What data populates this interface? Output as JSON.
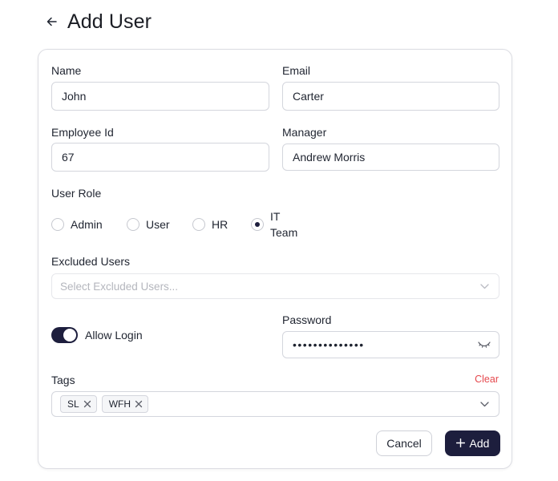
{
  "header": {
    "title": "Add User"
  },
  "form": {
    "name": {
      "label": "Name",
      "value": "John"
    },
    "email": {
      "label": "Email",
      "value": "Carter"
    },
    "employee_id": {
      "label": "Employee Id",
      "value": "67"
    },
    "manager": {
      "label": "Manager",
      "value": "Andrew Morris"
    },
    "user_role": {
      "label": "User Role",
      "options": [
        {
          "label": "Admin",
          "selected": false
        },
        {
          "label": "User",
          "selected": false
        },
        {
          "label": "HR",
          "selected": false
        },
        {
          "label": "IT Team",
          "selected": true
        }
      ]
    },
    "excluded_users": {
      "label": "Excluded Users",
      "placeholder": "Select Excluded Users..."
    },
    "allow_login": {
      "label": "Allow Login",
      "enabled": true
    },
    "password": {
      "label": "Password",
      "masked_value": "••••••••••••••"
    },
    "tags": {
      "label": "Tags",
      "clear_label": "Clear",
      "items": [
        "SL",
        "WFH"
      ]
    }
  },
  "actions": {
    "cancel_label": "Cancel",
    "add_label": "Add"
  },
  "colors": {
    "primary": "#1d1e3d",
    "danger": "#e5484d",
    "border": "#d4d6dd",
    "placeholder": "#b4b6bd"
  }
}
